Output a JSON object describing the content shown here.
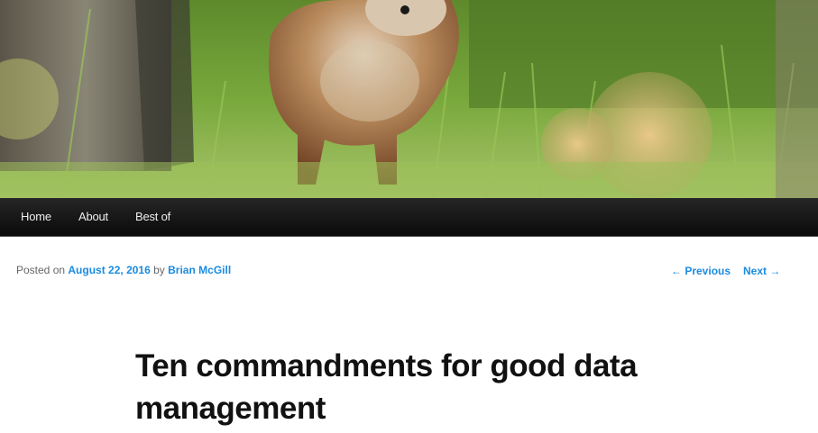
{
  "header": {
    "image_description_icon": "fox-in-grass-banner"
  },
  "nav": {
    "items": [
      {
        "label": "Home"
      },
      {
        "label": "About"
      },
      {
        "label": "Best of"
      }
    ]
  },
  "post": {
    "posted_on_label": "Posted on",
    "date": "August 22, 2016",
    "by_label": "by",
    "author": "Brian McGill",
    "title": "Ten commandments for good data management"
  },
  "post_nav": {
    "previous": "← Previous",
    "next": "Next →"
  },
  "colors": {
    "link": "#1b8be0",
    "nav_bg": "#111111",
    "title": "#111111"
  }
}
